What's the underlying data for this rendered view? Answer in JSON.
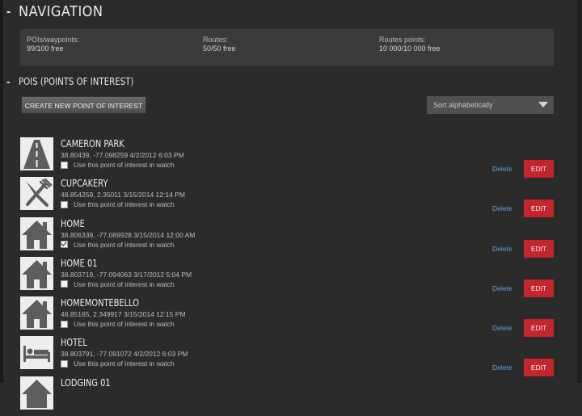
{
  "navigation": {
    "collapse_symbol": "-",
    "title": "NAVIGATION",
    "stats": [
      {
        "label": "POIs/waypoints:",
        "value": "99/100 free"
      },
      {
        "label": "Routes:",
        "value": "50/50 free"
      },
      {
        "label": "Routes points:",
        "value": "10 000/10 000 free"
      }
    ]
  },
  "pois": {
    "collapse_symbol": "-",
    "title": "POIS (POINTS OF INTEREST)",
    "create_button": "CREATE NEW POINT OF INTEREST",
    "sort_selected": "Sort alphabetically",
    "checkbox_label": "Use this point of interest in watch",
    "delete_label": "Delete",
    "edit_label": "EDIT",
    "items": [
      {
        "name": "CAMERON PARK",
        "coords": "38.80439, -77.098259 4/2/2012 6:03 PM",
        "icon": "road-icon",
        "in_watch": false
      },
      {
        "name": "CUPCAKERY",
        "coords": "48.854259, 2.35011 3/15/2014 12:14 PM",
        "icon": "fork-knife-icon",
        "in_watch": false
      },
      {
        "name": "HOME",
        "coords": "38.806339, -77.089928 3/15/2014 12:00 AM",
        "icon": "house-icon",
        "in_watch": true
      },
      {
        "name": "HOME 01",
        "coords": "38.803719, -77.094063 3/17/2012 5:04 PM",
        "icon": "house-icon",
        "in_watch": false
      },
      {
        "name": "HOMEMONTEBELLO",
        "coords": "48.85165, 2.349917 3/15/2014 12:15 PM",
        "icon": "house-icon",
        "in_watch": false
      },
      {
        "name": "HOTEL",
        "coords": "38.803791, -77.091072 4/2/2012 6:03 PM",
        "icon": "bed-icon",
        "in_watch": false
      },
      {
        "name": "LODGING 01",
        "coords": "",
        "icon": "house-icon",
        "in_watch": false
      }
    ]
  }
}
